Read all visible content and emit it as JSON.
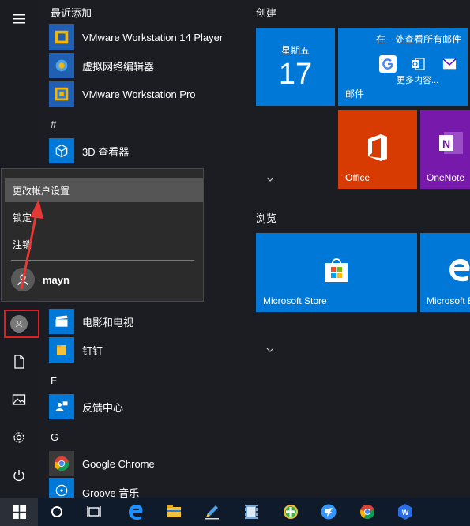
{
  "applist": {
    "recent_header": "最近添加",
    "recent_items": [
      {
        "label": "VMware Workstation 14 Player",
        "icon": "vmware-icon"
      },
      {
        "label": "虚拟网络编辑器",
        "icon": "network-editor-icon"
      },
      {
        "label": "VMware Workstation Pro",
        "icon": "vmware-pro-icon"
      }
    ],
    "hash_header": "#",
    "items_hash": [
      {
        "label": "3D 查看器",
        "icon": "3d-viewer-icon"
      }
    ],
    "items_d": [
      {
        "label": "电影和电视",
        "icon": "movies-tv-icon"
      },
      {
        "label": "钉钉",
        "icon": "folder-icon"
      }
    ],
    "f_header": "F",
    "items_f": [
      {
        "label": "反馈中心",
        "icon": "feedback-icon"
      }
    ],
    "g_header": "G",
    "items_g": [
      {
        "label": "Google Chrome",
        "icon": "chrome-icon"
      },
      {
        "label": "Groove 音乐",
        "icon": "groove-icon"
      }
    ]
  },
  "popup": {
    "items": [
      "更改帐户设置",
      "锁定",
      "注销"
    ],
    "user_name": "mayn"
  },
  "tiles": {
    "group1_title": "创建",
    "calendar_day": "星期五",
    "calendar_date": "17",
    "mail_title": "在一处查看所有邮件",
    "mail_more": "更多内容...",
    "mail_label": "邮件",
    "office_label": "Office",
    "onenote_label": "OneNote",
    "group2_title": "浏览",
    "store_label": "Microsoft Store",
    "edge_label": "Microsoft Edge"
  },
  "colors": {
    "tile_blue": "#0078d7",
    "office_orange": "#d83b01",
    "onenote_purple": "#7719aa",
    "highlight_red": "#e02020"
  }
}
